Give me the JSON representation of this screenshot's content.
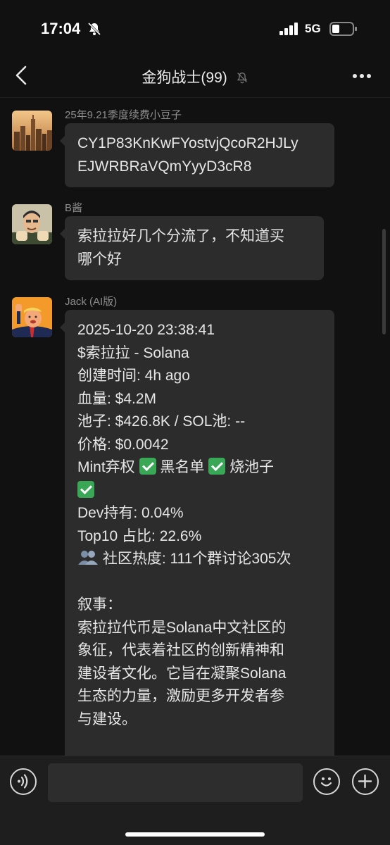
{
  "status_bar": {
    "time": "17:04",
    "network": "5G"
  },
  "nav": {
    "title": "金狗战士(99)",
    "icons": [
      "back-chevron-icon",
      "mute-bell-icon",
      "more-icon"
    ]
  },
  "messages": [
    {
      "sender": "25年9.21季度续费小豆子",
      "avatar": "city-skyline-avatar",
      "lines": [
        "CY1P83KnKwFYostvjQcoR2HJLy",
        "EJWRBRaVQmYyyD3cR8"
      ]
    },
    {
      "sender": "B酱",
      "avatar": "cartoon-man-avatar",
      "lines": [
        "索拉拉好几个分流了，不知道买",
        "哪个好"
      ]
    },
    {
      "sender": "Jack (AI版)",
      "avatar": "cartoon-trump-avatar",
      "lines": [
        "2025-10-20 23:38:41",
        "$索拉拉 - Solana",
        " 创建时间: 4h ago",
        " 血量: $4.2M",
        " 池子: $426.8K / SOL池: --",
        " 价格: $0.0042",
        " Mint弃权",
        "黑名单",
        "烧池子",
        " Dev持有: 0.04%",
        " Top10 占比: 22.6%",
        "社区热度: 111个群讨论305次",
        "",
        "叙事：",
        "索拉拉代币是Solana中文社区的",
        "象征，代表着社区的创新精神和",
        "建设者文化。它旨在凝聚Solana",
        "生态的力量，激励更多开发者参",
        "与建设。"
      ]
    }
  ],
  "input_bar": {
    "placeholder": "",
    "icons": [
      "voice-icon",
      "emoji-icon",
      "plus-icon"
    ]
  },
  "colors": {
    "background": "#111111",
    "bubble": "#2c2c2c",
    "check": "#3aa757"
  }
}
